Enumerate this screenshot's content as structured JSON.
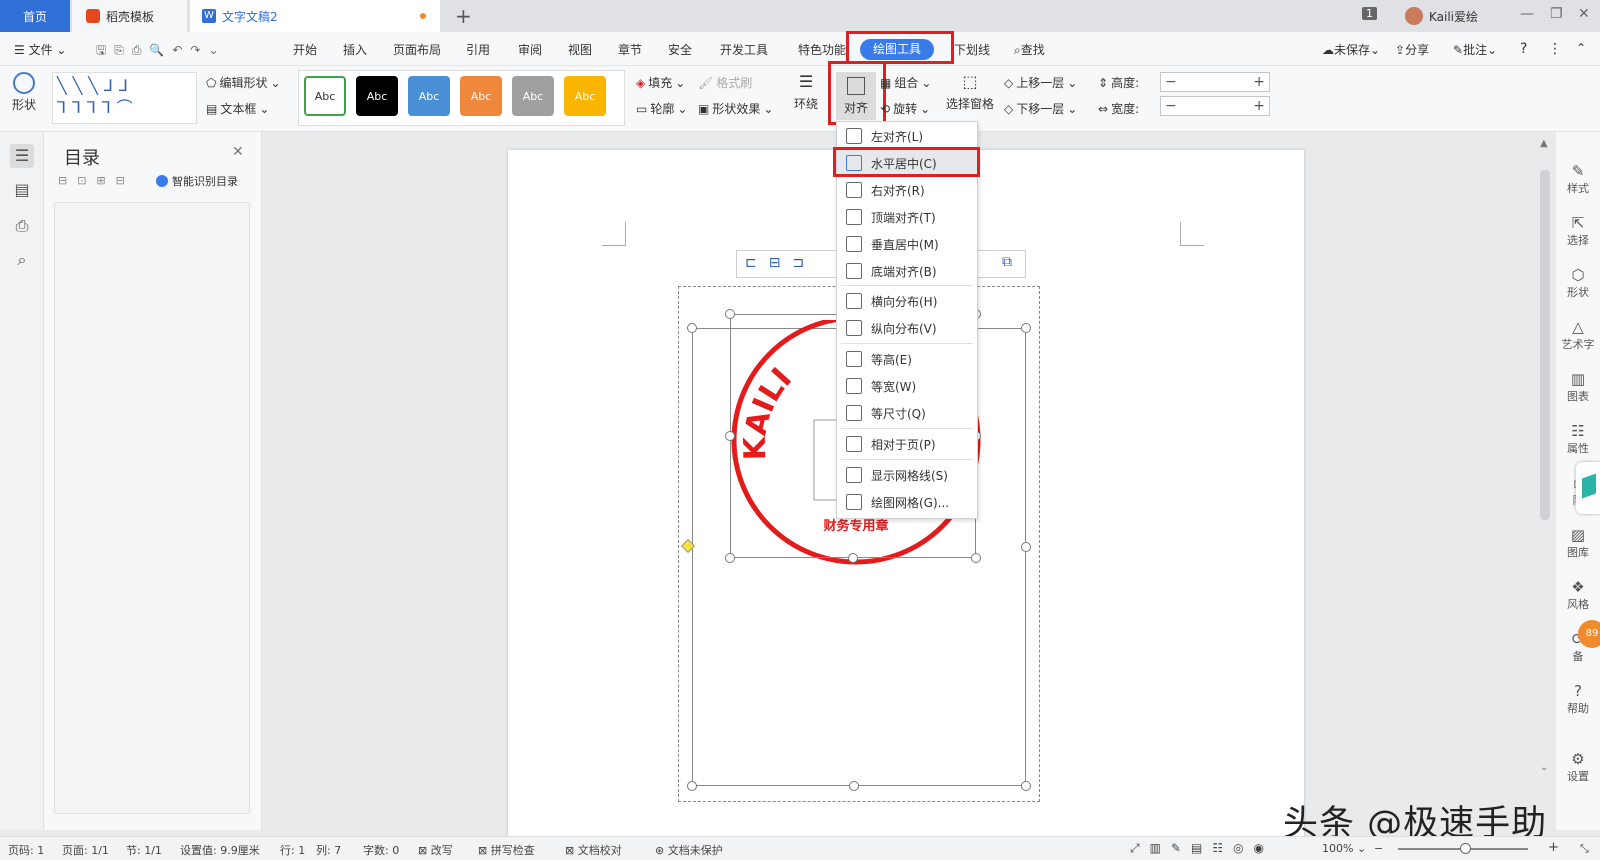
{
  "tabs": {
    "home": "首页",
    "template": "稻壳模板",
    "doc": "文字文稿2",
    "badge": "1",
    "user": "Kaili爱绘"
  },
  "menu": {
    "file": "文件",
    "items": [
      "开始",
      "插入",
      "页面布局",
      "引用",
      "审阅",
      "视图",
      "章节",
      "安全",
      "开发工具",
      "特色功能"
    ],
    "draw_tools": "绘图工具",
    "underline": "下划线",
    "find": "查找",
    "unsaved": "未保存",
    "share": "分享",
    "comment": "批注"
  },
  "ribbon": {
    "shape": "形状",
    "edit_shape": "编辑形状",
    "textbox": "文本框",
    "style_label": "Abc",
    "fill": "填充",
    "format_brush": "格式刷",
    "outline": "轮廓",
    "shape_effect": "形状效果",
    "wrap": "环绕",
    "align": "对齐",
    "group": "组合",
    "rotate": "旋转",
    "selection_pane": "选择窗格",
    "bring_forward": "上移一层",
    "send_backward": "下移一层",
    "height": "高度:",
    "width": "宽度:"
  },
  "styles": [
    {
      "bg": "#ffffff",
      "fg": "#333333",
      "border": "#3fa34d"
    },
    {
      "bg": "#000000",
      "fg": "#ffffff",
      "border": "#000000"
    },
    {
      "bg": "#4a90d6",
      "fg": "#ffffff",
      "border": "#4a90d6"
    },
    {
      "bg": "#f0883c",
      "fg": "#ffffff",
      "border": "#f0883c"
    },
    {
      "bg": "#a0a0a0",
      "fg": "#ffffff",
      "border": "#a0a0a0"
    },
    {
      "bg": "#f9b500",
      "fg": "#ffffff",
      "border": "#f9b500"
    }
  ],
  "toc": {
    "title": "目录",
    "smart": "智能识别目录"
  },
  "dropdown": [
    {
      "label": "左对齐(L)"
    },
    {
      "label": "水平居中(C)",
      "hl": true
    },
    {
      "label": "右对齐(R)"
    },
    {
      "label": "顶端对齐(T)"
    },
    {
      "label": "垂直居中(M)"
    },
    {
      "label": "底端对齐(B)"
    },
    {
      "label": "横向分布(H)"
    },
    {
      "label": "纵向分布(V)"
    },
    {
      "label": "等高(E)"
    },
    {
      "label": "等宽(W)"
    },
    {
      "label": "等尺寸(Q)"
    },
    {
      "label": "相对于页(P)"
    },
    {
      "label": "显示网格线(S)"
    },
    {
      "label": "绘图网格(G)..."
    }
  ],
  "seal": {
    "arc_text": "KAILI",
    "bottom_text": "财务专用章",
    "color": "#e31b1b"
  },
  "rightnav": [
    "样式",
    "选择",
    "形状",
    "艺术字",
    "图表",
    "属性",
    "限",
    "图库",
    "风格",
    "备",
    "帮助",
    "设置"
  ],
  "badge89": "89",
  "status": {
    "page": "页码: 1",
    "pages": "页面: 1/1",
    "section": "节: 1/1",
    "setting": "设置值: 9.9厘米",
    "row": "行: 1",
    "col": "列: 7",
    "words": "字数: 0",
    "revise": "改写",
    "spell": "拼写检查",
    "proof": "文档校对",
    "protect": "文档未保护",
    "zoom": "100%"
  },
  "watermark": "头条 @极速手助"
}
